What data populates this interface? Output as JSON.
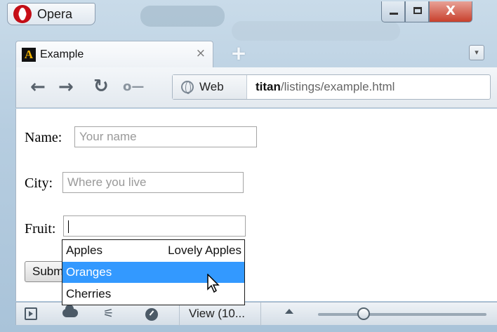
{
  "window": {
    "app_name": "Opera",
    "close_glyph": "X"
  },
  "tab": {
    "icon_letter": "A",
    "label": "Example",
    "close_glyph": "×",
    "new_tab_glyph": "+"
  },
  "toolbar": {
    "back_glyph": "←",
    "forward_glyph": "→",
    "reload_glyph": "↻",
    "key_glyph": "o—",
    "address_badge": "Web",
    "url_host": "titan",
    "url_path": "/listings/example.html"
  },
  "form": {
    "name_label": "Name:",
    "name_placeholder": "Your name",
    "city_label": "City:",
    "city_placeholder": "Where you live",
    "fruit_label": "Fruit:",
    "fruit_value": "",
    "submit_label": "Submit"
  },
  "autocomplete": {
    "options": [
      {
        "label": "Apples",
        "description": "Lovely Apples"
      },
      {
        "label": "Oranges",
        "description": ""
      },
      {
        "label": "Cherries",
        "description": ""
      }
    ],
    "selected_index": 1
  },
  "statusbar": {
    "view_label": "View (10...",
    "share_glyph": "⚟",
    "icons": [
      "panel-icon",
      "cloud-icon",
      "share-icon",
      "speedometer-icon"
    ],
    "zoom_level": "100"
  },
  "colors": {
    "selection": "#3399ff",
    "opera_red": "#d8111b"
  }
}
